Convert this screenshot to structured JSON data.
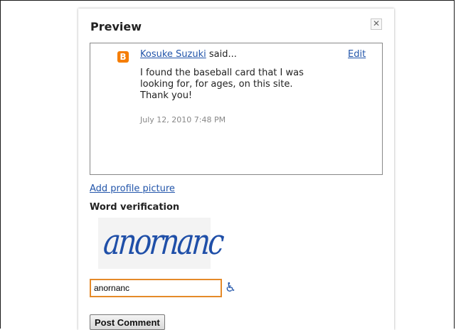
{
  "preview": {
    "title": "Preview",
    "close_icon": "close-icon",
    "comment": {
      "author": "Kosuke Suzuki",
      "said": " said...",
      "edit_label": "Edit",
      "text_lines": [
        "I found the baseball card that I was",
        "looking for, for ages, on this site.",
        "Thank you!"
      ],
      "date": "July 12, 2010 7:48 PM",
      "icon": "blogger-icon",
      "icon_color": "#f57d00"
    }
  },
  "profile": {
    "add_picture_label": "Add profile picture"
  },
  "verification": {
    "label": "Word verification",
    "captcha_word": "anornanc",
    "input_value": "anornanc",
    "accessibility_icon": "wheelchair-icon"
  },
  "actions": {
    "post_label": "Post Comment"
  },
  "colors": {
    "link": "#2255aa",
    "input_border": "#e58a29",
    "captcha_text": "#1f4fa8"
  }
}
